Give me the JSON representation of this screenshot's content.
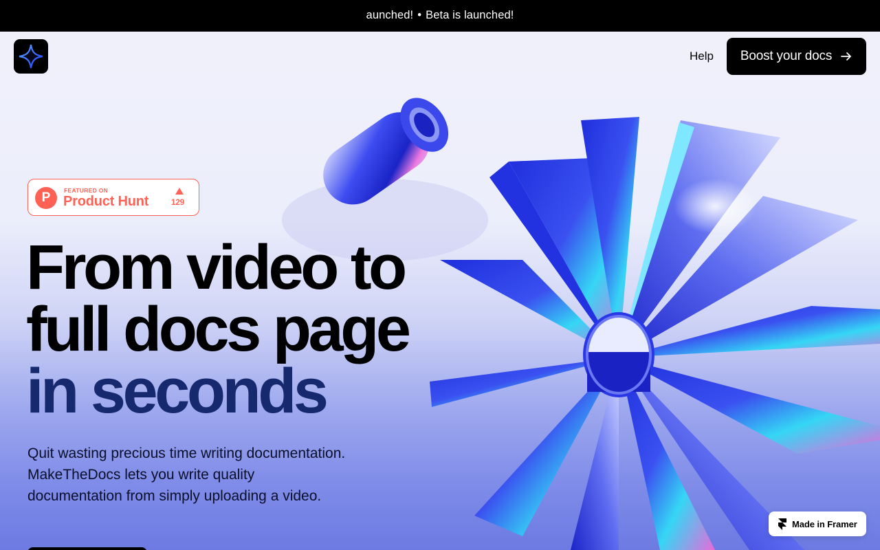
{
  "ticker": {
    "fragment": "aunched!",
    "separator": "•",
    "message": "Beta is launched!"
  },
  "nav": {
    "help_label": "Help",
    "cta_label": "Boost your docs"
  },
  "badge": {
    "featured": "FEATURED ON",
    "name": "Product Hunt",
    "votes": "129",
    "logo_letter": "P"
  },
  "hero": {
    "title_line1": "From video to",
    "title_line2": "full docs page",
    "title_line3": "in seconds",
    "subtitle": "Quit wasting precious time writing documentation. MakeTheDocs lets you write quality documentation from simply uploading a video."
  },
  "framer": {
    "label": "Made in Framer"
  },
  "colors": {
    "brand": "#000000",
    "accent": "#2b3ee8",
    "producthunt": "#ff6154",
    "title_dark_blue": "#16296e"
  },
  "icons": {
    "logo": "sparkle-star-icon",
    "cta": "arrow-right-icon",
    "framer": "framer-icon"
  }
}
